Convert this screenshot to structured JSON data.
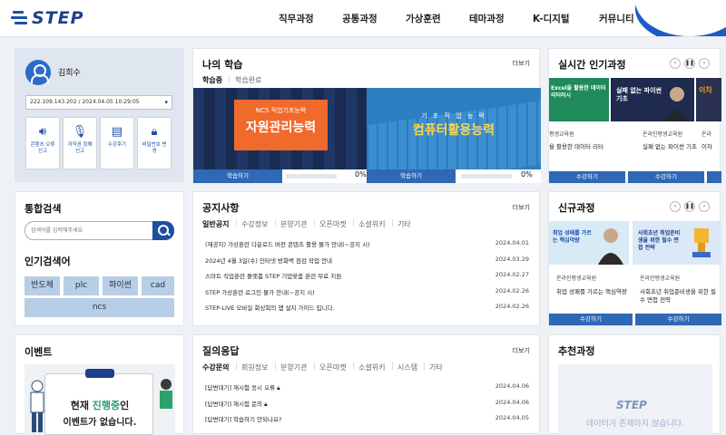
{
  "header": {
    "logo": "STEP",
    "nav": [
      "직무과정",
      "공통과정",
      "가상훈련",
      "테마과정",
      "K-디지털",
      "커뮤니티"
    ]
  },
  "profile": {
    "name": "김희수",
    "ip_login": "222.109.143.202 / 2024.04.05 10:29:05",
    "buttons": [
      {
        "label": "콘텐츠 오류 신고",
        "icon": "speaker-icon"
      },
      {
        "label": "저작권 침해 신고",
        "icon": "microphone-icon"
      },
      {
        "label": "수강후기",
        "icon": "notebook-icon"
      },
      {
        "label": "비밀번호 변경",
        "icon": "lock-icon"
      }
    ]
  },
  "search": {
    "title": "통합검색",
    "placeholder": "검색어를 입력해주세요",
    "popular_title": "인기검색어",
    "keywords": [
      "반도체",
      "plc",
      "파이썬",
      "cad",
      "ncs"
    ]
  },
  "event": {
    "title": "이벤트",
    "line1_prefix": "현재 ",
    "line1_highlight": "진행중",
    "line1_suffix": "인",
    "line2": "이벤트가 없습니다."
  },
  "learning": {
    "title": "나의 학습",
    "more": "더보기",
    "tabs": [
      "학습중",
      "학습완료"
    ],
    "courses": [
      {
        "subtitle": "NCS 직업기초능력",
        "name": "자원관리능력",
        "button": "학습하기",
        "progress": "0%"
      },
      {
        "subtitle": "기 초 직 업 능 력",
        "name": "컴퓨터활용능력",
        "button": "학습하기",
        "progress": "0%"
      }
    ]
  },
  "notice": {
    "title": "공지사항",
    "more": "더보기",
    "tabs": [
      "일반공지",
      "수강정보",
      "분양기관",
      "오픈마켓",
      "소셜위키",
      "기타"
    ],
    "rows": [
      {
        "title": "(재공지) 가상훈련 다운로드 버전 콘텐츠 활용 불가 안내(~공지 시)",
        "date": "2024.04.01"
      },
      {
        "title": "2024년 4월 3일(수) 인터넷 방화벽 점검 작업 안내",
        "date": "2024.03.29"
      },
      {
        "title": "스마트 직업훈련 플랫폼 STEP 기업맞춤 훈련 무료 지원",
        "date": "2024.02.27"
      },
      {
        "title": "STEP 가상훈련 로그인 불가 안내(~공지 시)",
        "date": "2024.02.26"
      },
      {
        "title": "STEP-LIVE 모바일 화상회의 앱 설치 가이드 입니다.",
        "date": "2024.02.26"
      }
    ]
  },
  "qna": {
    "title": "질의응답",
    "more": "더보기",
    "tabs": [
      "수강문의",
      "회원정보",
      "분양기관",
      "오픈마켓",
      "소셜위키",
      "시스템",
      "기타"
    ],
    "rows": [
      {
        "title": "[답변대기] 재시험 응시 오류",
        "date": "2024.04.06"
      },
      {
        "title": "[답변대기] 재시험 문의",
        "date": "2024.04.06"
      },
      {
        "title": "[답변대기] 학습하기 안되나요?",
        "date": "2024.04.05"
      }
    ]
  },
  "popular": {
    "title": "실시간 인기과정",
    "courses": [
      {
        "org": "평생교육원",
        "name": "을 활용한 데이터 리터",
        "thumb": "Excel을 활용한 데이터 리터러시",
        "button": "수강하기"
      },
      {
        "org": "온라인평생교육원",
        "name": "실패 없는 파이썬 기초",
        "thumb": "실패 없는 파이썬 기초",
        "button": "수강하기"
      },
      {
        "org": "온라",
        "name": "이차",
        "thumb": "이차",
        "button": ""
      }
    ]
  },
  "new_courses": {
    "title": "신규과정",
    "courses": [
      {
        "org": "온라인평생교육원",
        "name": "취업 성패를 가르는 핵심역량",
        "thumb": "취업 성패를 가르는 핵심역량",
        "button": "수강하기"
      },
      {
        "org": "온라인평생교육원",
        "name": "사회초년 취업준비생을 위한 필수 면접 전략",
        "thumb": "사회초년 취업준비생을 위한 필수 면접 전략",
        "button": "수강하기"
      }
    ]
  },
  "recommend": {
    "title": "추천과정",
    "logo": "STEP",
    "message": "데이터가 존재하지 않습니다."
  }
}
